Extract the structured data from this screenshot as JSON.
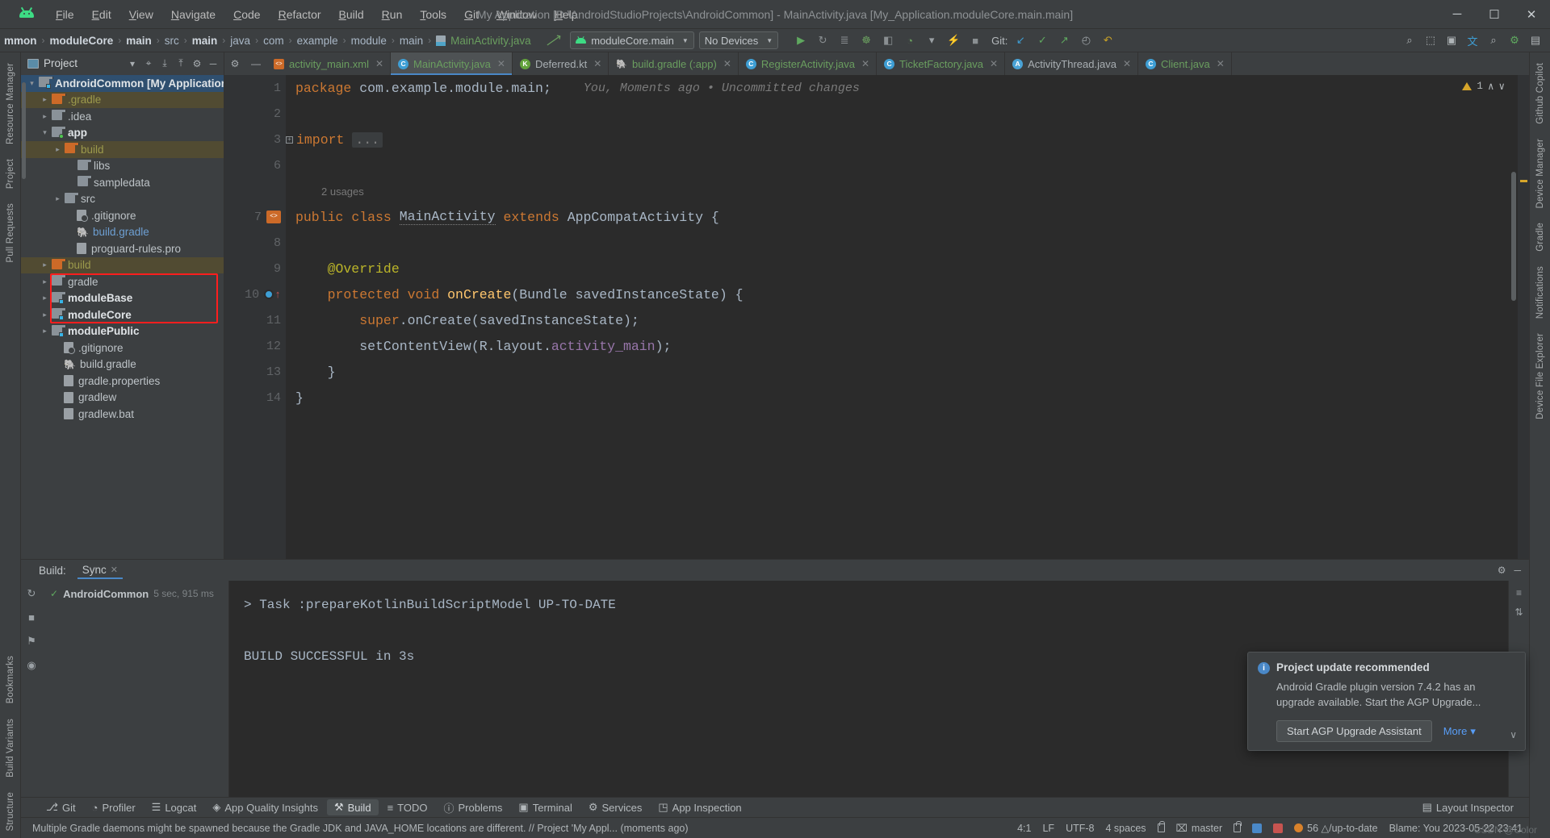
{
  "window": {
    "title": "My Application [D:\\AndroidStudioProjects\\AndroidCommon] - MainActivity.java [My_Application.moduleCore.main.main]",
    "logo": "android-logo",
    "minimize": "─",
    "maximize": "☐",
    "close": "✕"
  },
  "menubar": [
    {
      "label": "File"
    },
    {
      "label": "Edit"
    },
    {
      "label": "View"
    },
    {
      "label": "Navigate"
    },
    {
      "label": "Code"
    },
    {
      "label": "Refactor"
    },
    {
      "label": "Build"
    },
    {
      "label": "Run"
    },
    {
      "label": "Tools"
    },
    {
      "label": "Git"
    },
    {
      "label": "Window"
    },
    {
      "label": "Help"
    }
  ],
  "breadcrumbs": [
    {
      "label": "mmon",
      "style": "bold"
    },
    {
      "label": "moduleCore",
      "style": "bold"
    },
    {
      "label": "main",
      "style": "bold"
    },
    {
      "label": "src",
      "style": "normal"
    },
    {
      "label": "main",
      "style": "bold"
    },
    {
      "label": "java",
      "style": "normal"
    },
    {
      "label": "com",
      "style": "normal"
    },
    {
      "label": "example",
      "style": "normal"
    },
    {
      "label": "module",
      "style": "normal"
    },
    {
      "label": "main",
      "style": "normal"
    },
    {
      "label": "MainActivity.java",
      "style": "green-file"
    }
  ],
  "toolbar": {
    "run_config": "moduleCore.main",
    "device": "No Devices",
    "git_label": "Git:",
    "icons": [
      {
        "name": "run-icon",
        "glyph": "▶",
        "color": "#5fa85f"
      },
      {
        "name": "rerun-icon",
        "glyph": "↻",
        "color": "#8a8f92"
      },
      {
        "name": "run-with-coverage-icon",
        "glyph": "≣",
        "color": "#8a8f92"
      },
      {
        "name": "debug-icon",
        "glyph": "☸",
        "color": "#6a9e5f"
      },
      {
        "name": "attach-debugger-icon",
        "glyph": "◧",
        "color": "#8a8f92"
      },
      {
        "name": "profile-icon",
        "glyph": "◔",
        "color": "#6a9e5f"
      },
      {
        "name": "profile-dropdown-icon",
        "glyph": "▾",
        "color": "#9aa0a4"
      },
      {
        "name": "apply-changes-icon",
        "glyph": "⚡",
        "color": "#6a9e5f"
      },
      {
        "name": "stop-icon",
        "glyph": "■",
        "color": "#8a8f92"
      }
    ],
    "git_icons": [
      {
        "name": "git-update-icon",
        "glyph": "↙",
        "color": "#3e9ed4"
      },
      {
        "name": "git-commit-icon",
        "glyph": "✓",
        "color": "#5fa85f"
      },
      {
        "name": "git-push-icon",
        "glyph": "↗",
        "color": "#5fa85f"
      },
      {
        "name": "git-history-icon",
        "glyph": "◴",
        "color": "#9aa0a4"
      },
      {
        "name": "undo-icon",
        "glyph": "↶",
        "color": "#c9a227"
      }
    ],
    "right_icons": [
      {
        "name": "search-everywhere-icon",
        "glyph": "⌕",
        "color": "#b0b5b8"
      },
      {
        "name": "device-manager-icon",
        "glyph": "⬚",
        "color": "#b0b5b8"
      },
      {
        "name": "avd-icon",
        "glyph": "▣",
        "color": "#b0b5b8"
      },
      {
        "name": "translate-icon",
        "glyph": "文",
        "color": "#3e9ed4"
      },
      {
        "name": "search-icon",
        "glyph": "⌕",
        "color": "#b0b5b8"
      },
      {
        "name": "account-icon",
        "glyph": "⚙",
        "color": "#5fa85f"
      },
      {
        "name": "layout-icon",
        "glyph": "▤",
        "color": "#b0b5b8"
      }
    ]
  },
  "left_rail": [
    {
      "label": "Resource Manager",
      "name": "rail-resource-manager"
    },
    {
      "label": "Project",
      "name": "rail-project"
    },
    {
      "label": "Pull Requests",
      "name": "rail-pull-requests"
    }
  ],
  "left_rail_bottom": [
    {
      "label": "Bookmarks",
      "name": "rail-bookmarks"
    },
    {
      "label": "Build Variants",
      "name": "rail-build-variants"
    },
    {
      "label": "Structure",
      "name": "rail-structure"
    }
  ],
  "right_rail": [
    {
      "label": "Github Copilot",
      "name": "rail-github-copilot"
    },
    {
      "label": "Device Manager",
      "name": "rail-device-manager"
    },
    {
      "label": "Gradle",
      "name": "rail-gradle"
    },
    {
      "label": "Notifications",
      "name": "rail-notifications"
    },
    {
      "label": "Device File Explorer",
      "name": "rail-device-file-explorer"
    }
  ],
  "project_panel": {
    "title": "Project",
    "header_icons": [
      {
        "name": "project-view-dropdown-icon",
        "glyph": "▾"
      },
      {
        "name": "locate-icon",
        "glyph": "⌖"
      },
      {
        "name": "expand-all-icon",
        "glyph": "⤓"
      },
      {
        "name": "collapse-all-icon",
        "glyph": "⤒"
      },
      {
        "name": "settings-gear-icon",
        "glyph": "⚙"
      },
      {
        "name": "hide-panel-icon",
        "glyph": "─"
      }
    ],
    "tree": [
      {
        "label": "AndroidCommon [My Application]",
        "indent": 0,
        "twisty": "open",
        "icon": "module-folder",
        "style": "bold",
        "state": "selected"
      },
      {
        "label": ".gradle",
        "indent": 1,
        "twisty": "closed",
        "icon": "folder-orange",
        "style": "olive",
        "state": "highlight"
      },
      {
        "label": ".idea",
        "indent": 1,
        "twisty": "closed",
        "icon": "folder",
        "style": "normal",
        "state": ""
      },
      {
        "label": "app",
        "indent": 1,
        "twisty": "open",
        "icon": "module-folder-green",
        "style": "bold",
        "state": ""
      },
      {
        "label": "build",
        "indent": 2,
        "twisty": "closed",
        "icon": "folder-orange",
        "style": "olive",
        "state": "highlight"
      },
      {
        "label": "libs",
        "indent": 3,
        "twisty": "none",
        "icon": "folder",
        "style": "normal",
        "state": ""
      },
      {
        "label": "sampledata",
        "indent": 3,
        "twisty": "none",
        "icon": "folder",
        "style": "normal",
        "state": ""
      },
      {
        "label": "src",
        "indent": 2,
        "twisty": "closed",
        "icon": "folder",
        "style": "normal",
        "state": ""
      },
      {
        "label": ".gitignore",
        "indent": 3,
        "twisty": "none",
        "icon": "gitignore-file",
        "style": "normal",
        "state": ""
      },
      {
        "label": "build.gradle",
        "indent": 3,
        "twisty": "none",
        "icon": "gradle-file",
        "style": "blue",
        "state": ""
      },
      {
        "label": "proguard-rules.pro",
        "indent": 3,
        "twisty": "none",
        "icon": "text-file",
        "style": "normal",
        "state": ""
      },
      {
        "label": "build",
        "indent": 1,
        "twisty": "closed",
        "icon": "folder-orange",
        "style": "olive",
        "state": "highlight"
      },
      {
        "label": "gradle",
        "indent": 1,
        "twisty": "closed",
        "icon": "folder",
        "style": "normal",
        "state": ""
      },
      {
        "label": "moduleBase",
        "indent": 1,
        "twisty": "closed",
        "icon": "module-folder",
        "style": "bold",
        "state": ""
      },
      {
        "label": "moduleCore",
        "indent": 1,
        "twisty": "closed",
        "icon": "module-folder",
        "style": "bold",
        "state": ""
      },
      {
        "label": "modulePublic",
        "indent": 1,
        "twisty": "closed",
        "icon": "module-folder",
        "style": "bold",
        "state": ""
      },
      {
        "label": ".gitignore",
        "indent": 2,
        "twisty": "none",
        "icon": "gitignore-file",
        "style": "normal",
        "state": ""
      },
      {
        "label": "build.gradle",
        "indent": 2,
        "twisty": "none",
        "icon": "gradle-file",
        "style": "normal",
        "state": ""
      },
      {
        "label": "gradle.properties",
        "indent": 2,
        "twisty": "none",
        "icon": "properties-file",
        "style": "normal",
        "state": ""
      },
      {
        "label": "gradlew",
        "indent": 2,
        "twisty": "none",
        "icon": "text-file",
        "style": "normal",
        "state": ""
      },
      {
        "label": "gradlew.bat",
        "indent": 2,
        "twisty": "none",
        "icon": "text-file",
        "style": "normal",
        "state": ""
      }
    ]
  },
  "editor": {
    "tabs": [
      {
        "label": "activity_main.xml",
        "icon": "xml-icon",
        "active": false,
        "color": "green"
      },
      {
        "label": "MainActivity.java",
        "icon": "java-class-icon",
        "active": true,
        "color": "green"
      },
      {
        "label": "Deferred.kt",
        "icon": "kotlin-icon",
        "active": false,
        "color": "grey"
      },
      {
        "label": "build.gradle (:app)",
        "icon": "gradle-icon",
        "active": false,
        "color": "green"
      },
      {
        "label": "RegisterActivity.java",
        "icon": "java-class-icon",
        "active": false,
        "color": "green"
      },
      {
        "label": "TicketFactory.java",
        "icon": "java-class-icon",
        "active": false,
        "color": "green"
      },
      {
        "label": "ActivityThread.java",
        "icon": "java-readonly-icon",
        "active": false,
        "color": "grey"
      },
      {
        "label": "Client.java",
        "icon": "java-class-icon",
        "active": false,
        "color": "green"
      }
    ],
    "inspection": {
      "count": "1",
      "up": "∧",
      "down": "∨"
    },
    "gutter_hint": "You, Moments ago • Uncommitted changes",
    "usages_hint": "2 usages",
    "lines": [
      {
        "num": "1",
        "tokens": [
          {
            "t": "package ",
            "c": "kw"
          },
          {
            "t": "com.example.module.main;",
            "c": "id"
          }
        ]
      },
      {
        "num": "2",
        "tokens": []
      },
      {
        "num": "3",
        "tokens": [
          {
            "t": "import ",
            "c": "kw"
          },
          {
            "t": "...",
            "c": "fold"
          }
        ],
        "fold": true
      },
      {
        "num": "6",
        "tokens": []
      },
      {
        "num": "",
        "tokens": [
          {
            "t": "2 usages",
            "c": "usages"
          }
        ],
        "usages": true
      },
      {
        "num": "7",
        "tokens": [
          {
            "t": "public ",
            "c": "kw"
          },
          {
            "t": "class ",
            "c": "kw"
          },
          {
            "t": "MainActivity",
            "c": "wavy"
          },
          {
            "t": " extends ",
            "c": "kw"
          },
          {
            "t": "AppCompatActivity",
            "c": "id"
          },
          {
            "t": " {",
            "c": "id"
          }
        ]
      },
      {
        "num": "8",
        "tokens": []
      },
      {
        "num": "9",
        "tokens": [
          {
            "t": "    @Override",
            "c": "ann"
          }
        ]
      },
      {
        "num": "10",
        "tokens": [
          {
            "t": "    protected ",
            "c": "kw"
          },
          {
            "t": "void ",
            "c": "kw"
          },
          {
            "t": "onCreate",
            "c": "fn"
          },
          {
            "t": "(",
            "c": "id"
          },
          {
            "t": "Bundle",
            "c": "id"
          },
          {
            "t": " savedInstanceState) {",
            "c": "id"
          }
        ]
      },
      {
        "num": "11",
        "tokens": [
          {
            "t": "        ",
            "c": "id"
          },
          {
            "t": "super",
            "c": "kw"
          },
          {
            "t": ".onCreate(savedInstanceState);",
            "c": "id"
          }
        ]
      },
      {
        "num": "12",
        "tokens": [
          {
            "t": "        setContentView(R.layout.",
            "c": "id"
          },
          {
            "t": "activity_main",
            "c": "fld"
          },
          {
            "t": ");",
            "c": "id"
          }
        ]
      },
      {
        "num": "13",
        "tokens": [
          {
            "t": "    }",
            "c": "id"
          }
        ]
      },
      {
        "num": "14",
        "tokens": [
          {
            "t": "}",
            "c": "id"
          }
        ]
      }
    ]
  },
  "build_panel": {
    "label": "Build:",
    "tab": "Sync",
    "tab_close": "✕",
    "header_right": [
      {
        "name": "build-settings-gear-icon",
        "glyph": "⚙"
      },
      {
        "name": "hide-build-panel-icon",
        "glyph": "─"
      }
    ],
    "rail_icons": [
      {
        "name": "restart-sync-icon",
        "glyph": "↻"
      },
      {
        "name": "stop-build-icon",
        "glyph": "■"
      },
      {
        "name": "pin-tab-icon",
        "glyph": "⚑"
      },
      {
        "name": "toggle-view-icon",
        "glyph": "◉"
      }
    ],
    "tree": [
      {
        "status": "✓",
        "label": "AndroidCommon",
        "duration": "5 sec, 915 ms"
      }
    ],
    "output": [
      "> Task :prepareKotlinBuildScriptModel UP-TO-DATE",
      "",
      "BUILD SUCCESSFUL in 3s"
    ],
    "right_rail_icons": [
      {
        "name": "build-filter-icon",
        "glyph": "≡"
      },
      {
        "name": "build-sort-icon",
        "glyph": "⇅"
      }
    ]
  },
  "notification": {
    "icon": "info-icon",
    "title": "Project update recommended",
    "body": "Android Gradle plugin version 7.4.2 has an upgrade available. Start the AGP Upgrade...",
    "primary_button": "Start AGP Upgrade Assistant",
    "more_link": "More",
    "more_caret": "▾",
    "collapse_caret": "∨"
  },
  "bottom_tools": [
    {
      "label": "Git",
      "icon": "git-branch-icon",
      "glyph": "⎇",
      "active": false
    },
    {
      "label": "Profiler",
      "icon": "profiler-icon",
      "glyph": "◔",
      "active": false
    },
    {
      "label": "Logcat",
      "icon": "logcat-icon",
      "glyph": "☰",
      "active": false
    },
    {
      "label": "App Quality Insights",
      "icon": "insights-icon",
      "glyph": "◈",
      "active": false
    },
    {
      "label": "Build",
      "icon": "build-hammer-icon",
      "glyph": "⚒",
      "active": true
    },
    {
      "label": "TODO",
      "icon": "todo-icon",
      "glyph": "≡",
      "active": false
    },
    {
      "label": "Problems",
      "icon": "problems-icon",
      "glyph": "ⓘ",
      "active": false
    },
    {
      "label": "Terminal",
      "icon": "terminal-icon",
      "glyph": "▣",
      "active": false
    },
    {
      "label": "Services",
      "icon": "services-icon",
      "glyph": "⚙",
      "active": false
    },
    {
      "label": "App Inspection",
      "icon": "app-inspection-icon",
      "glyph": "◳",
      "active": false
    }
  ],
  "bottom_right": {
    "layout_inspector": "Layout Inspector",
    "layout_icon": "layout-inspector-icon"
  },
  "statusbar": {
    "message": "Multiple Gradle daemons might be spawned because the Gradle JDK and JAVA_HOME locations are different. // Project 'My Appl... (moments ago)",
    "caret": "4:1",
    "line_ending": "LF",
    "encoding": "UTF-8",
    "indent": "4 spaces",
    "lock_icon": "read-only-lock-icon",
    "branch": "master",
    "branch_icon": "git-branch-icon",
    "updates": "56 △/up-to-date",
    "blame": "Blame: You 2023-05-22 23:41",
    "watermark": "CSDN @Color"
  }
}
